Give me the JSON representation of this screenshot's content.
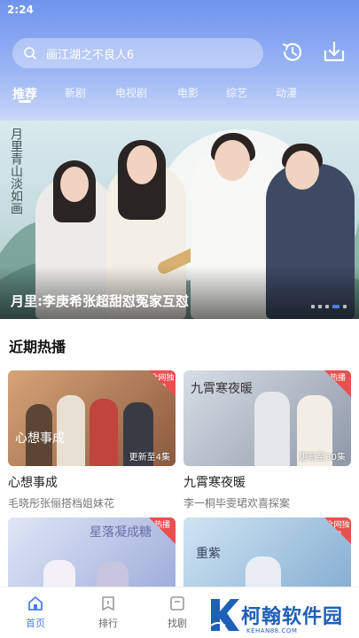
{
  "status_bar": {
    "time": "2:24"
  },
  "search": {
    "query": "画江湖之不良人6"
  },
  "header": {
    "history_icon": "history-icon",
    "download_icon": "download-icon"
  },
  "tabs": [
    {
      "label": "推荐",
      "active": true
    },
    {
      "label": "新剧",
      "active": false
    },
    {
      "label": "电视剧",
      "active": false
    },
    {
      "label": "电影",
      "active": false
    },
    {
      "label": "综艺",
      "active": false
    },
    {
      "label": "动漫",
      "active": false
    }
  ],
  "banner": {
    "title": "月里:李庚希张超甜怼冤家互怼",
    "calligraphy": "月里青山淡如画",
    "slide_count": 5,
    "active_slide": 4
  },
  "recent": {
    "section_title": "近期热播",
    "cards": [
      {
        "title": "心想事成",
        "subtitle": "毛晓彤张俪搭档姐妹花",
        "episode": "更新至4集",
        "badge": "全网独播",
        "art_title": "心想事成"
      },
      {
        "title": "九霄寒夜暖",
        "subtitle": "李一桐毕雯珺欢喜探案",
        "episode": "更新至30集",
        "badge": "热播",
        "art_title": "九霄寒夜暖"
      },
      {
        "title": "",
        "subtitle": "",
        "episode": "",
        "badge": "热播",
        "art_title": "星落凝成糖"
      },
      {
        "title": "",
        "subtitle": "",
        "episode": "",
        "badge": "全网独播",
        "art_title": "重紫"
      }
    ]
  },
  "bottom_nav": [
    {
      "label": "首页",
      "active": true
    },
    {
      "label": "排行",
      "active": false
    },
    {
      "label": "找剧",
      "active": false
    }
  ],
  "watermark": {
    "text": "柯翰软件园",
    "sub": "KEHAN88.COM"
  },
  "colors": {
    "accent": "#4c7cf3",
    "badge": "#e8504f",
    "header_top": "#6f93ee"
  }
}
